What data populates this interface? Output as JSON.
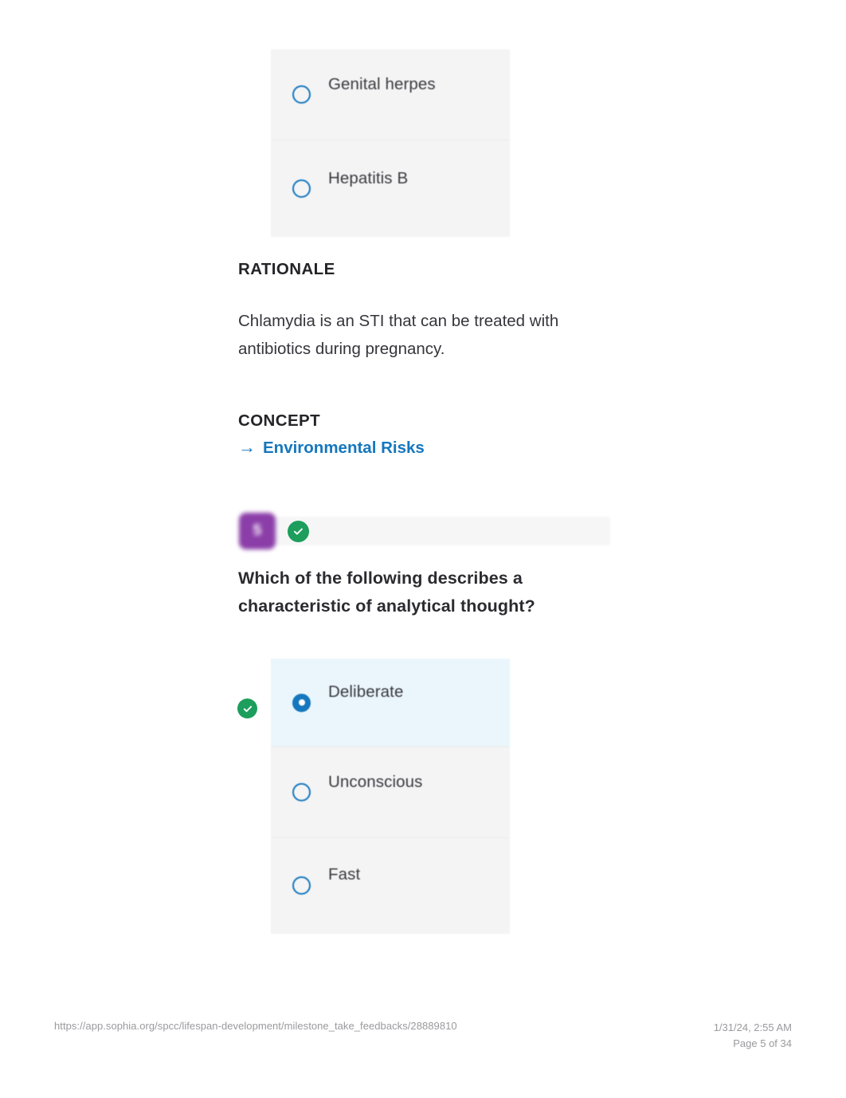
{
  "document": {
    "footer": {
      "url": "https://app.sophia.org/spcc/lifespan-development/milestone_take_feedbacks/28889810",
      "timestamp": "1/31/24, 2:55 AM",
      "page_label": "Page 5 of 34"
    }
  },
  "colors": {
    "accent_blue": "#1577be",
    "correct_green": "#1d9e5c",
    "badge_purple": "#8b3da8",
    "card_gray": "#f4f4f5",
    "selected_blue": "#eaf6fb"
  },
  "previous_question": {
    "options": [
      {
        "label": "Genital herpes",
        "selected": false
      },
      {
        "label": "Hepatitis B",
        "selected": false
      }
    ],
    "rationale": {
      "heading": "RATIONALE",
      "text": "Chlamydia is an STI that can be treated with antibiotics during pregnancy."
    },
    "concept": {
      "heading": "CONCEPT",
      "arrow": "→",
      "link_label": "Environmental Risks"
    }
  },
  "question_5": {
    "number": "5",
    "status_icon": "check-circle-icon",
    "title": "Which of the following describes a characteristic of analytical thought?",
    "options": [
      {
        "label": "Deliberate",
        "selected": true,
        "correct": true
      },
      {
        "label": "Unconscious",
        "selected": false,
        "correct": false
      },
      {
        "label": "Fast",
        "selected": false,
        "correct": false
      }
    ]
  }
}
